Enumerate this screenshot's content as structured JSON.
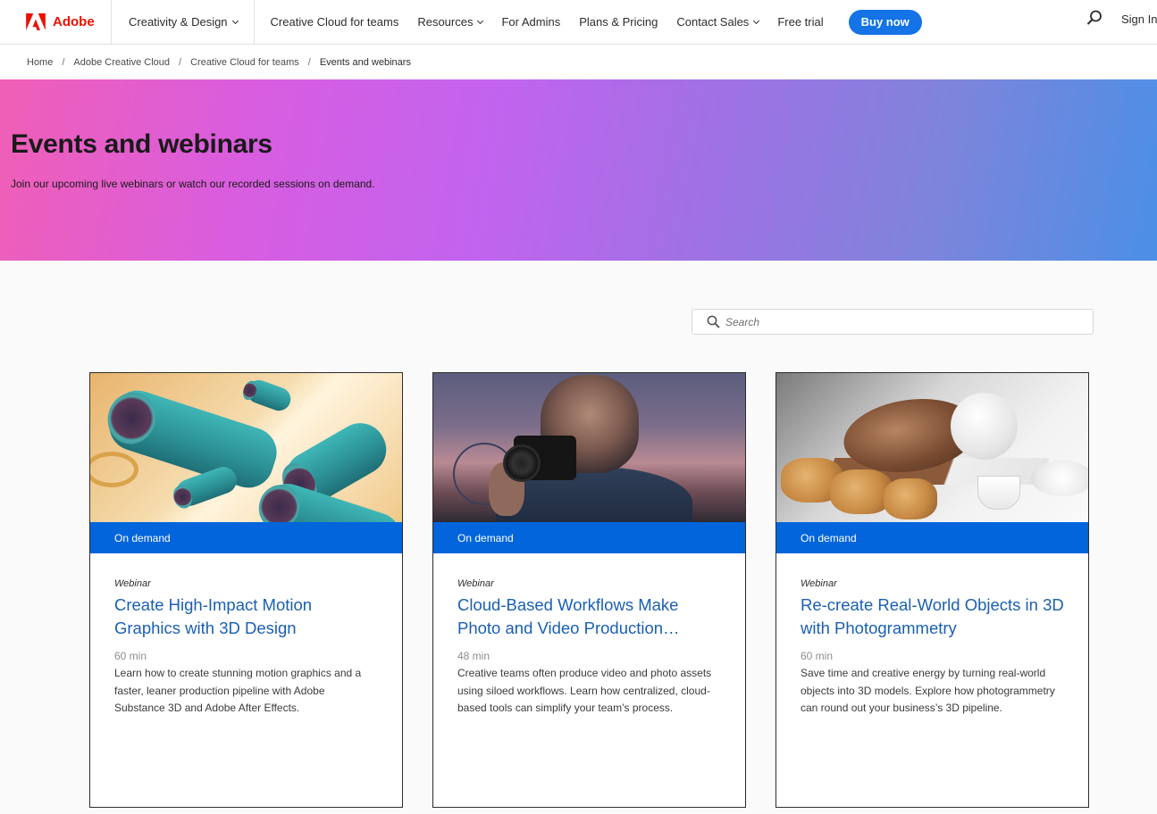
{
  "nav": {
    "brand": "Adobe",
    "items": [
      {
        "label": "Creativity & Design",
        "has_menu": true
      },
      {
        "label": "Creative Cloud for teams",
        "has_menu": false
      },
      {
        "label": "Resources",
        "has_menu": true
      },
      {
        "label": "For Admins",
        "has_menu": false
      },
      {
        "label": "Plans & Pricing",
        "has_menu": false
      },
      {
        "label": "Contact Sales",
        "has_menu": true
      },
      {
        "label": "Free trial",
        "has_menu": false
      }
    ],
    "buy_label": "Buy now",
    "signin_label": "Sign In",
    "brand_color": "#eb1000",
    "accent_color": "#1473e6"
  },
  "breadcrumb": [
    "Home",
    "Adobe Creative Cloud",
    "Creative Cloud for teams",
    "Events and webinars"
  ],
  "hero": {
    "title": "Events and webinars",
    "subtitle": "Join our upcoming live webinars or watch our recorded sessions on demand."
  },
  "search": {
    "placeholder": "Search"
  },
  "cards": [
    {
      "badge": "On demand",
      "type": "Webinar",
      "title": "Create High-Impact Motion Graphics with 3D Design",
      "duration": "60 min",
      "description": "Learn how to create stunning motion graphics and a faster, leaner production pipeline with Adobe Substance 3D and Adobe After Effects."
    },
    {
      "badge": "On demand",
      "type": "Webinar",
      "title": "Cloud-Based Workflows Make Photo and Video Production…",
      "duration": "48 min",
      "description": "Creative teams often produce video and photo assets using siloed workflows. Learn how centralized, cloud-based tools can simplify your team’s process."
    },
    {
      "badge": "On demand",
      "type": "Webinar",
      "title": "Re-create Real-World Objects in 3D with Photogrammetry",
      "duration": "60 min",
      "description": "Save time and creative energy by turning real-world objects into 3D models. Explore how photogrammetry can round out your business’s 3D pipeline."
    }
  ]
}
